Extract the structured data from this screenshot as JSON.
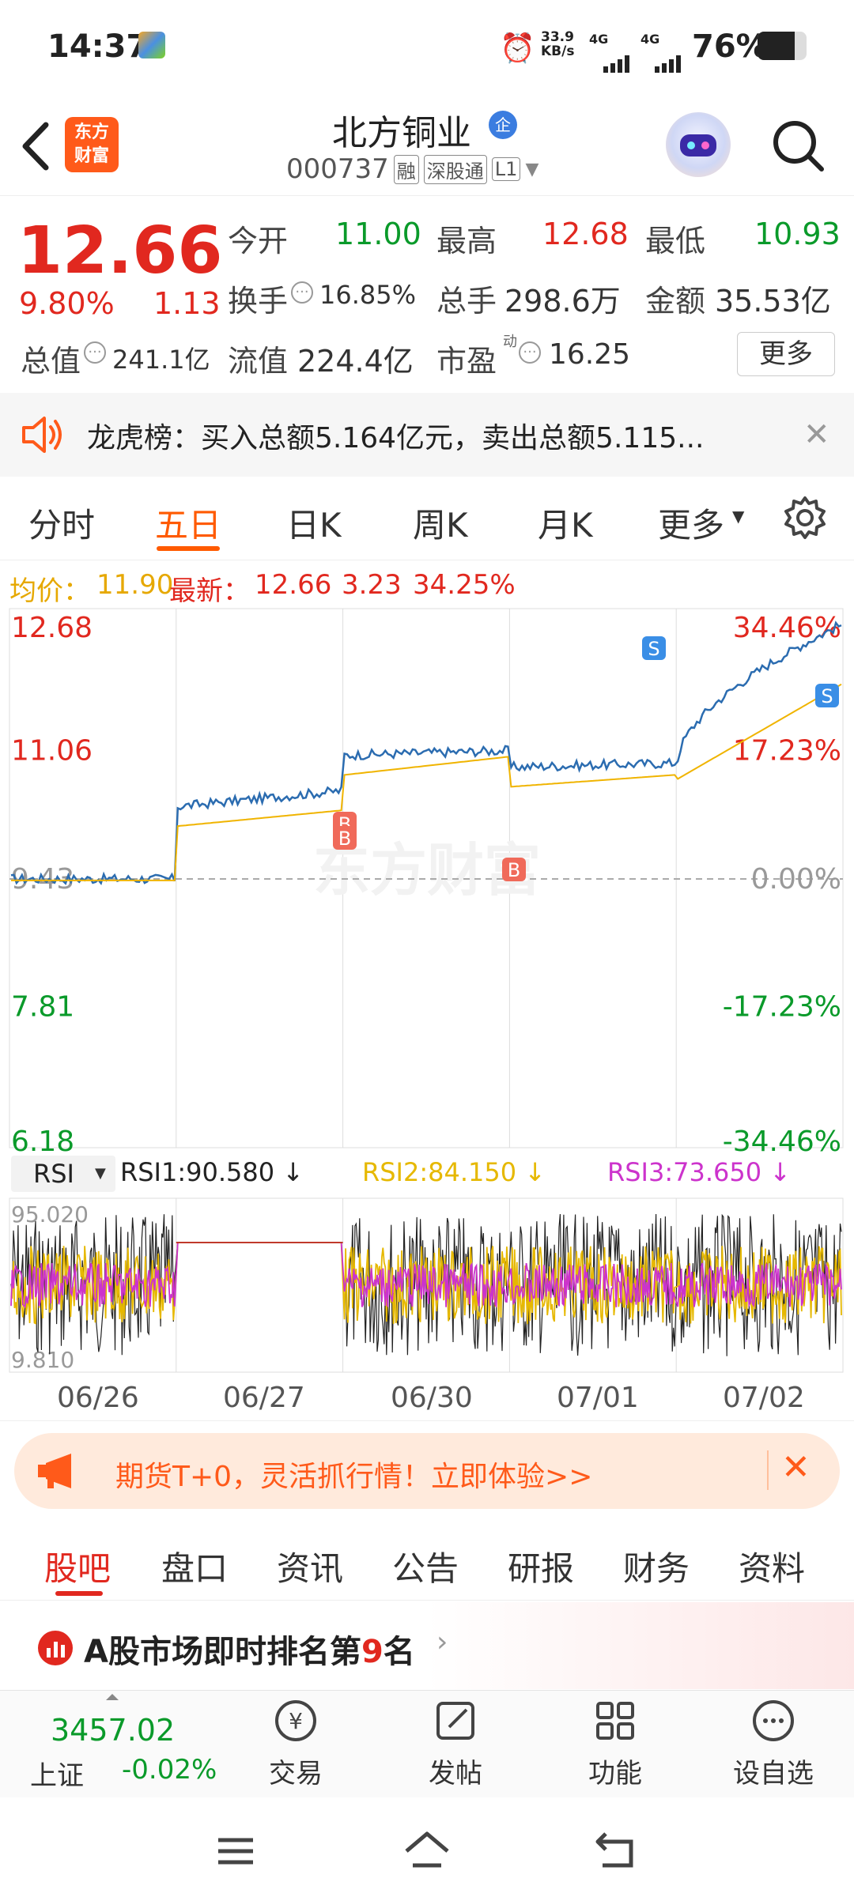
{
  "status": {
    "time": "14:37",
    "net_speed_top": "33.9",
    "net_speed_bot": "KB/s",
    "sig1": "4G",
    "sig2": "4G",
    "battery": "76%"
  },
  "header": {
    "logo_line1": "东方",
    "logo_line2": "财富",
    "title": "北方铜业",
    "badge": "企",
    "code": "000737",
    "tag1": "融",
    "tag2": "深股通",
    "tag3": "L1"
  },
  "quote": {
    "price": "12.66",
    "pct": "9.80%",
    "change": "1.13",
    "open_label": "今开",
    "open": "11.00",
    "high_label": "最高",
    "high": "12.68",
    "low_label": "最低",
    "low": "10.93",
    "turnover_label": "换手",
    "turnover": "16.85%",
    "vol_label": "总手",
    "vol": "298.6万",
    "amt_label": "金额",
    "amt": "35.53亿",
    "mcap_label": "总值",
    "mcap": "241.1亿",
    "float_label": "流值",
    "float": "224.4亿",
    "pe_label": "市盈",
    "pe_sup": "动",
    "pe": "16.25",
    "more": "更多"
  },
  "notice": {
    "text": "龙虎榜：买入总额5.164亿元，卖出总额5.115..."
  },
  "tabs": [
    "分时",
    "五日",
    "日K",
    "周K",
    "月K",
    "更多"
  ],
  "chartinfo": {
    "avg_label": "均价：",
    "avg": "11.90",
    "latest_label": "最新：",
    "latest": "12.66",
    "chg": "3.23",
    "pct": "34.25%"
  },
  "chart_data": {
    "type": "line",
    "title": "",
    "x": [
      "06/26",
      "06/27",
      "06/30",
      "07/01",
      "07/02"
    ],
    "y_left_ticks": [
      "12.68",
      "11.06",
      "9.43",
      "7.81",
      "6.18"
    ],
    "y_right_ticks": [
      "34.46%",
      "17.23%",
      "0.00%",
      "-17.23%",
      "-34.46%"
    ],
    "ylim": [
      6.18,
      12.68
    ],
    "series": [
      {
        "name": "",
        "color": "#2b6cb0",
        "values": [
          9.43,
          10.55,
          11.06,
          10.9,
          12.66
        ]
      },
      {
        "name": "",
        "color": "#f0b400",
        "values": [
          9.41,
          10.3,
          10.98,
          10.75,
          11.9
        ]
      }
    ],
    "markers": [
      {
        "label": "S",
        "color": "#3a8ee6"
      },
      {
        "label": "S",
        "color": "#3a8ee6"
      },
      {
        "label": "B",
        "color": "#f06a5a"
      },
      {
        "label": "B",
        "color": "#f06a5a"
      },
      {
        "label": "B",
        "color": "#f06a5a"
      }
    ],
    "watermark": "东方财富"
  },
  "rsi": {
    "select": "RSI",
    "rsi1": "RSI1:90.580 ↓",
    "rsi2": "RSI2:84.150 ↓",
    "rsi3": "RSI3:73.650 ↓",
    "top": "95.020",
    "bottom": "9.810",
    "colors": {
      "rsi1": "#222222",
      "rsi2": "#e6b800",
      "rsi3": "#cc33cc"
    }
  },
  "ad": {
    "text": "期货T+0，灵活抓行情！立即体验>>"
  },
  "bottom_tabs": [
    "股吧",
    "盘口",
    "资讯",
    "公告",
    "研报",
    "财务",
    "资料"
  ],
  "rank": {
    "prefix": "A股市场即时排名第",
    "num": "9",
    "suffix": "名"
  },
  "index": {
    "value": "3457.02",
    "name": "上证",
    "pct": "-0.02%"
  },
  "nav": [
    "交易",
    "发帖",
    "功能",
    "设自选"
  ]
}
